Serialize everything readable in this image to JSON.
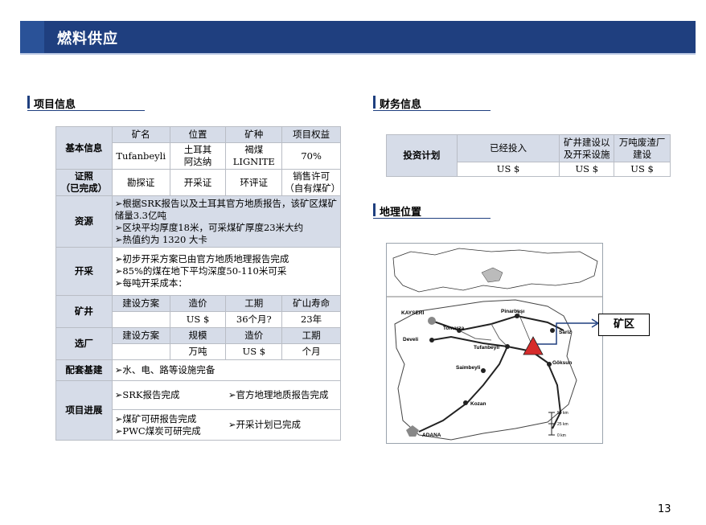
{
  "header": {
    "title": "燃料供应"
  },
  "sections": {
    "project": "项目信息",
    "finance": "财务信息",
    "location": "地理位置"
  },
  "project_table": {
    "basic_label": "基本信息",
    "col_mine_name": "矿名",
    "col_location": "位置",
    "col_coal_type": "矿种",
    "col_equity": "项目权益",
    "mine_name": "Tufanbeyli",
    "location": "土耳其\n阿达纳",
    "coal_type": "褐煤\nLIGNITE",
    "equity": "70%",
    "license_label": "证照\n（已完成）",
    "license_1": "勘探证",
    "license_2": "开采证",
    "license_3": "环评证",
    "license_4": "销售许可\n（自有煤矿）",
    "resource_label": "资源",
    "resource_lines": [
      "➢根据SRK报告以及土耳其官方地质报告，该矿区煤矿储量3.3亿吨",
      "➢区块平均厚度18米，可采煤矿厚度23米大约",
      "➢热值约为 1320 大卡"
    ],
    "mining_label": "开采",
    "mining_lines": [
      "➢初步开采方案已由官方地质地理报告完成",
      "➢85%的煤在地下平均深度50-110米可采",
      "➢每吨开采成本："
    ],
    "shaft_label": "矿井",
    "shaft_headers": [
      "建设方案",
      "造价",
      "工期",
      "矿山寿命"
    ],
    "shaft_values": [
      "",
      "US $",
      "36个月?",
      "23年"
    ],
    "plant_label": "选厂",
    "plant_headers": [
      "建设方案",
      "规模",
      "造价",
      "工期"
    ],
    "plant_values": [
      "",
      "万吨",
      "US $",
      "个月"
    ],
    "infra_label": "配套基建",
    "infra_text": "➢水、电、路等设施完备",
    "progress_label": "项目进展",
    "progress_items": [
      "➢SRK报告完成",
      "➢官方地理地质报告完成",
      "➢煤矿可研报告完成\n➢PWC煤炭可研完成",
      "➢开采计划已完成"
    ]
  },
  "finance_table": {
    "row_label": "投资计划",
    "headers": [
      "已经投入",
      "矿井建设以及开采设施",
      "万吨废渣厂建设"
    ],
    "values": [
      "US $",
      "US $",
      "US $"
    ]
  },
  "map": {
    "places": [
      "KAYSERI",
      "Pinarbaşı",
      "Tomarza",
      "Sariz",
      "Develi",
      "Tufanbeyli",
      "Saimbeyli",
      "Göksun",
      "Kozan",
      "ADANA"
    ],
    "scale": [
      "50 km",
      "25 km",
      "0 km"
    ],
    "callout": "矿区"
  },
  "page_number": "13",
  "colors": {
    "banner": "#1f3f7f",
    "table_header": "#d6dce8",
    "mine_marker": "#d62b2b"
  }
}
